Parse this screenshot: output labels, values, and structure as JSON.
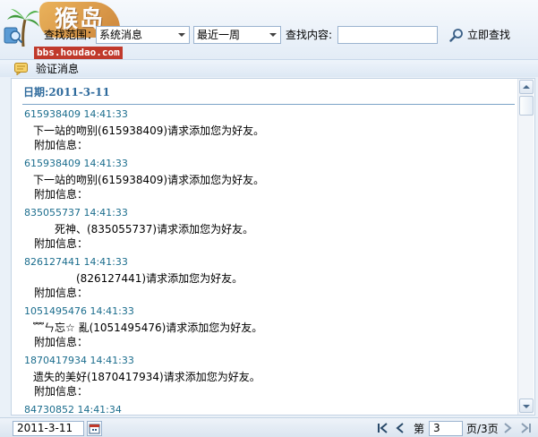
{
  "watermark": {
    "logo_text": "猴岛",
    "url_text": "bbs.houdao.com"
  },
  "toolbar": {
    "scope_label": "查找范围：",
    "scope_value": "系统消息",
    "time_value": "最近一周",
    "search_label": "查找内容:",
    "search_value": "",
    "search_button_label": "立即查找"
  },
  "section": {
    "title": "验证消息"
  },
  "content": {
    "date_header": "日期:2011-3-11",
    "messages": [
      {
        "meta": "615938409  14:41:33",
        "body": "下一站的吻别(615938409)请求添加您为好友。",
        "extra": "附加信息："
      },
      {
        "meta": "615938409  14:41:33",
        "body": "下一站的吻别(615938409)请求添加您为好友。",
        "extra": "附加信息："
      },
      {
        "meta": "835055737  14:41:33",
        "body": "死神、(835055737)请求添加您为好友。",
        "extra": "附加信息："
      },
      {
        "meta": "826127441  14:41:33",
        "body": "(826127441)请求添加您为好友。",
        "extra": "附加信息："
      },
      {
        "meta": "1051495476  14:41:33",
        "body": "﹌ㄣ忘☆ 亂(1051495476)请求添加您为好友。",
        "extra": "附加信息："
      },
      {
        "meta": "1870417934  14:41:33",
        "body": "遗失的美好(1870417934)请求添加您为好友。",
        "extra": "附加信息："
      },
      {
        "meta": "84730852  14:41:34",
        "body": "",
        "extra": ""
      }
    ]
  },
  "footer": {
    "date_value": "2011-3-11",
    "page_prefix": "第",
    "current_page": "3",
    "page_suffix": "页/3页"
  },
  "colors": {
    "meta_text": "#1b6d8d",
    "date_header": "#2e6a9c",
    "rule": "#7ba3c7"
  }
}
